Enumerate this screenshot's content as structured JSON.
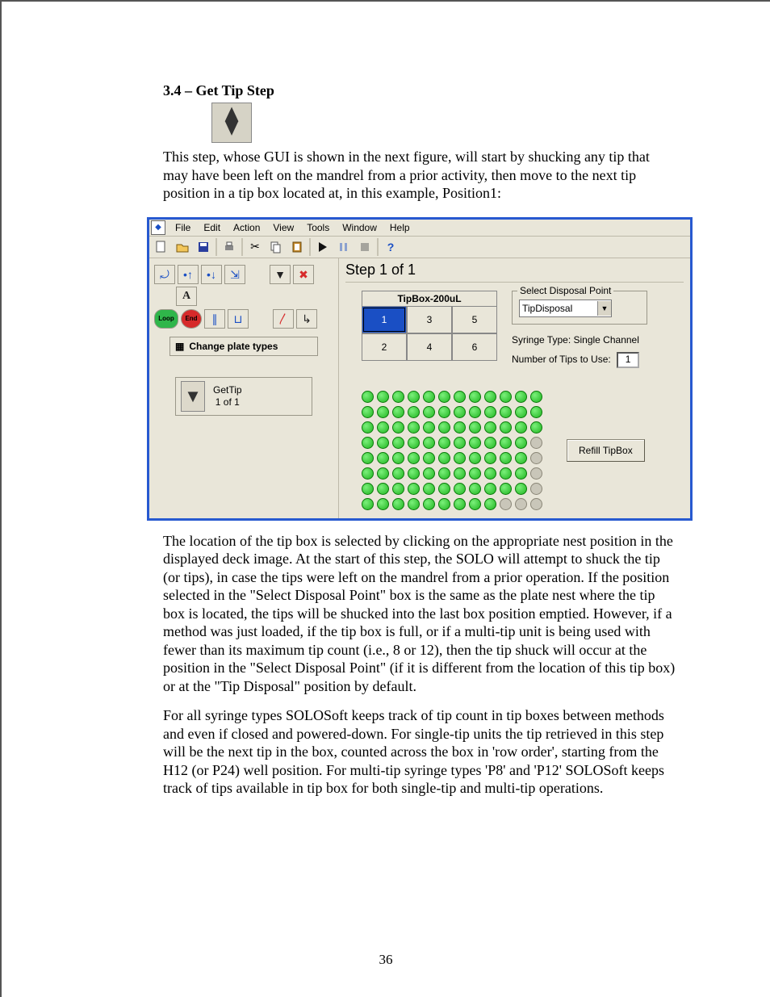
{
  "heading": "3.4 – Get Tip Step",
  "paragraph1": "This step, whose GUI is shown in the next figure, will start by shucking any tip that may have been left on the mandrel from a prior activity, then move to the next tip position in a tip box located at, in this example, Position1:",
  "paragraph2": " The location of the tip box is selected by clicking on the appropriate nest position in the displayed deck image.  At the start of this step, the SOLO will attempt to shuck the tip (or tips), in case the tips were left on the mandrel from a prior operation.  If the position selected in the \"Select Disposal Point\" box is the same as the plate nest where the tip box is located, the tips will be shucked into the last box position emptied.  However, if a method was just loaded, if the tip box is full, or if a multi-tip unit is being used with fewer than its maximum tip count (i.e., 8 or 12), then the tip shuck will occur at the position in the \"Select Disposal Point\" (if it is different from the location of this tip box) or at the \"Tip Disposal\" position by default.",
  "paragraph3": "For all syringe types SOLOSoft keeps track of tip count in tip boxes between methods and even if closed and powered-down.  For single-tip units the tip retrieved in this step will be the next tip in the box, counted across the box in 'row order', starting from the H12 (or P24) well position.  For multi-tip syringe types 'P8' and 'P12' SOLOSoft keeps track of tips available in tip box for both single-tip and multi-tip operations.",
  "page_number": "36",
  "menu": {
    "items": [
      "File",
      "Edit",
      "Action",
      "View",
      "Tools",
      "Window",
      "Help"
    ]
  },
  "sidebar": {
    "change_plate_label": "Change plate types",
    "step_item": {
      "title": "GetTip",
      "sub": "1 of 1"
    }
  },
  "main": {
    "step_head": "Step 1 of 1",
    "deck_title": "TipBox-200uL",
    "deck_cells": [
      "1",
      "3",
      "5",
      "2",
      "4",
      "6"
    ],
    "deck_selected_index": 0,
    "disposal": {
      "legend": "Select Disposal Point",
      "value": "TipDisposal"
    },
    "syringe_line": "Syringe Type: Single Channel",
    "tips_label": "Number of Tips to Use:",
    "tips_value": "1",
    "refill_label": "Refill TipBox",
    "tipgrid": {
      "rows": 8,
      "cols": 12,
      "empty": [
        "3,11",
        "4,11",
        "5,11",
        "6,11",
        "7,9",
        "7,10",
        "7,11"
      ]
    }
  }
}
